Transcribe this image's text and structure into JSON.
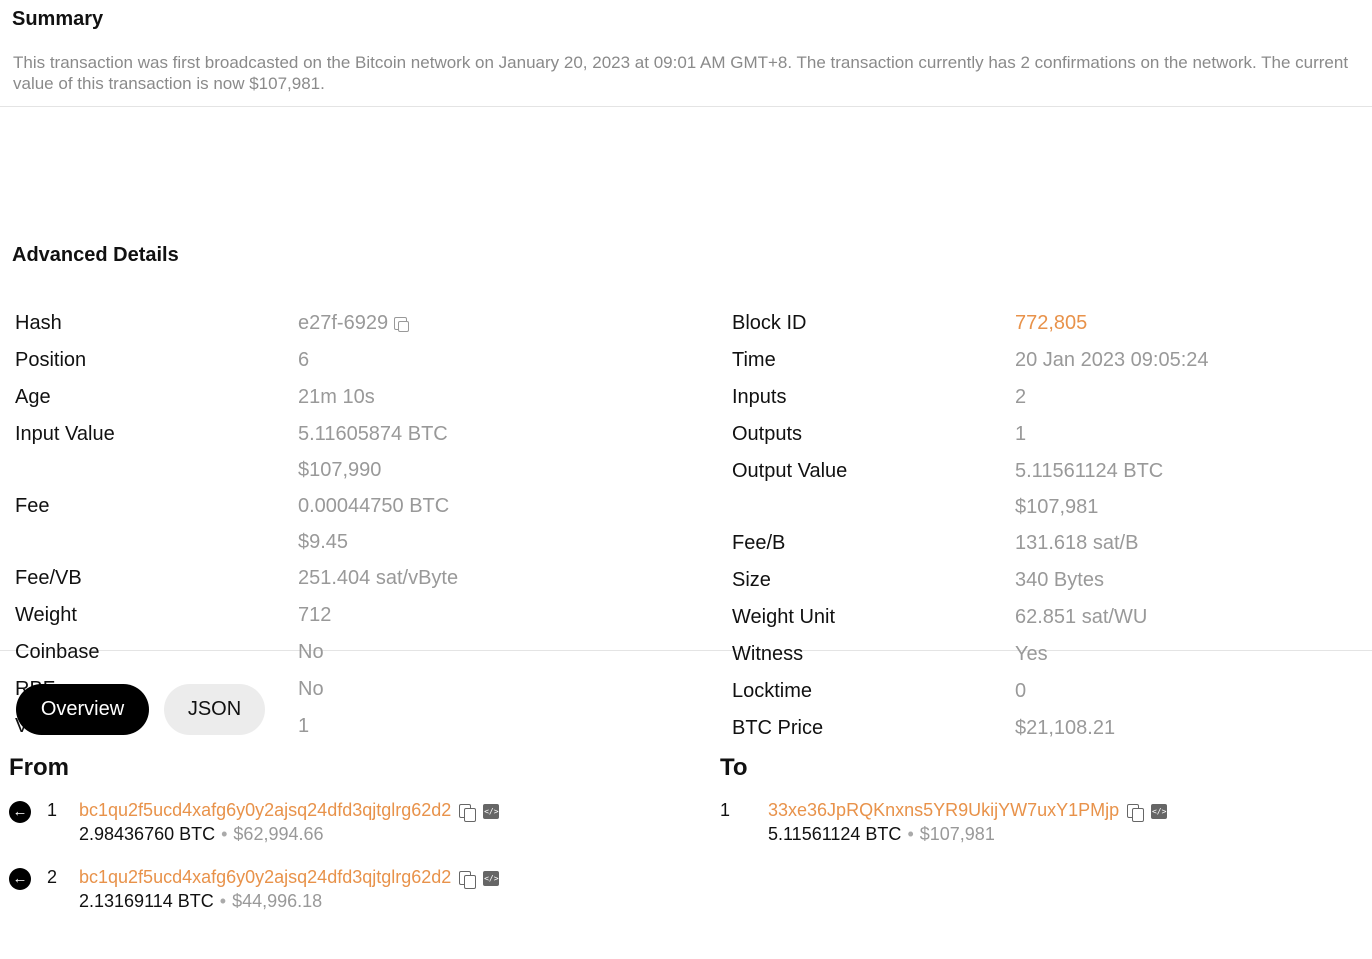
{
  "summary": {
    "title": "Summary",
    "text": "This transaction was first broadcasted on the Bitcoin network on January 20, 2023 at 09:01 AM GMT+8. The transaction currently has 2 confirmations on the network. The current value of this transaction is now $107,981."
  },
  "advanced": {
    "title": "Advanced Details",
    "left": [
      {
        "label": "Hash",
        "value": "e27f-6929"
      },
      {
        "label": "Position",
        "value": "6"
      },
      {
        "label": "Age",
        "value": "21m 10s"
      },
      {
        "label": "Input Value",
        "value": "5.11605874 BTC",
        "sub": "$107,990"
      },
      {
        "label": "Fee",
        "value": "0.00044750 BTC",
        "sub": "$9.45"
      },
      {
        "label": "Fee/VB",
        "value": "251.404 sat/vByte"
      },
      {
        "label": "Weight",
        "value": "712"
      },
      {
        "label": "Coinbase",
        "value": "No"
      },
      {
        "label": "RBF",
        "value": "No"
      },
      {
        "label": "Version",
        "value": "1"
      }
    ],
    "right": [
      {
        "label": "Block ID",
        "value": "772,805"
      },
      {
        "label": "Time",
        "value": "20 Jan 2023 09:05:24"
      },
      {
        "label": "Inputs",
        "value": "2"
      },
      {
        "label": "Outputs",
        "value": "1"
      },
      {
        "label": "Output Value",
        "value": "5.11561124 BTC",
        "sub": "$107,981"
      },
      {
        "label": "Fee/B",
        "value": "131.618 sat/B"
      },
      {
        "label": "Size",
        "value": "340 Bytes"
      },
      {
        "label": "Weight Unit",
        "value": "62.851 sat/WU"
      },
      {
        "label": "Witness",
        "value": "Yes"
      },
      {
        "label": "Locktime",
        "value": "0"
      },
      {
        "label": "BTC Price",
        "value": "$21,108.21"
      }
    ]
  },
  "tabs": [
    {
      "label": "Overview",
      "active": true
    },
    {
      "label": "JSON",
      "active": false
    }
  ],
  "from": {
    "title": "From",
    "entries": [
      {
        "index": "1",
        "address": "bc1qu2f5ucd4xafg6y0y2ajsq24dfd3qjtglrg62d2",
        "btc": "2.98436760 BTC",
        "usd": "$62,994.66"
      },
      {
        "index": "2",
        "address": "bc1qu2f5ucd4xafg6y0y2ajsq24dfd3qjtglrg62d2",
        "btc": "2.13169114 BTC",
        "usd": "$44,996.18"
      }
    ]
  },
  "to": {
    "title": "To",
    "entries": [
      {
        "index": "1",
        "address": "33xe36JpRQKnxns5YR9UkijYW7uxY1PMjp",
        "btc": "5.11561124 BTC",
        "usd": "$107,981"
      }
    ]
  },
  "icons": {
    "copy": "copy-icon",
    "code": "code-icon",
    "arrow": "arrow-left-icon"
  },
  "colors": {
    "link": "#e8924a",
    "muted": "#999999",
    "active_tab_bg": "#000000",
    "inactive_tab_bg": "#ececec"
  }
}
